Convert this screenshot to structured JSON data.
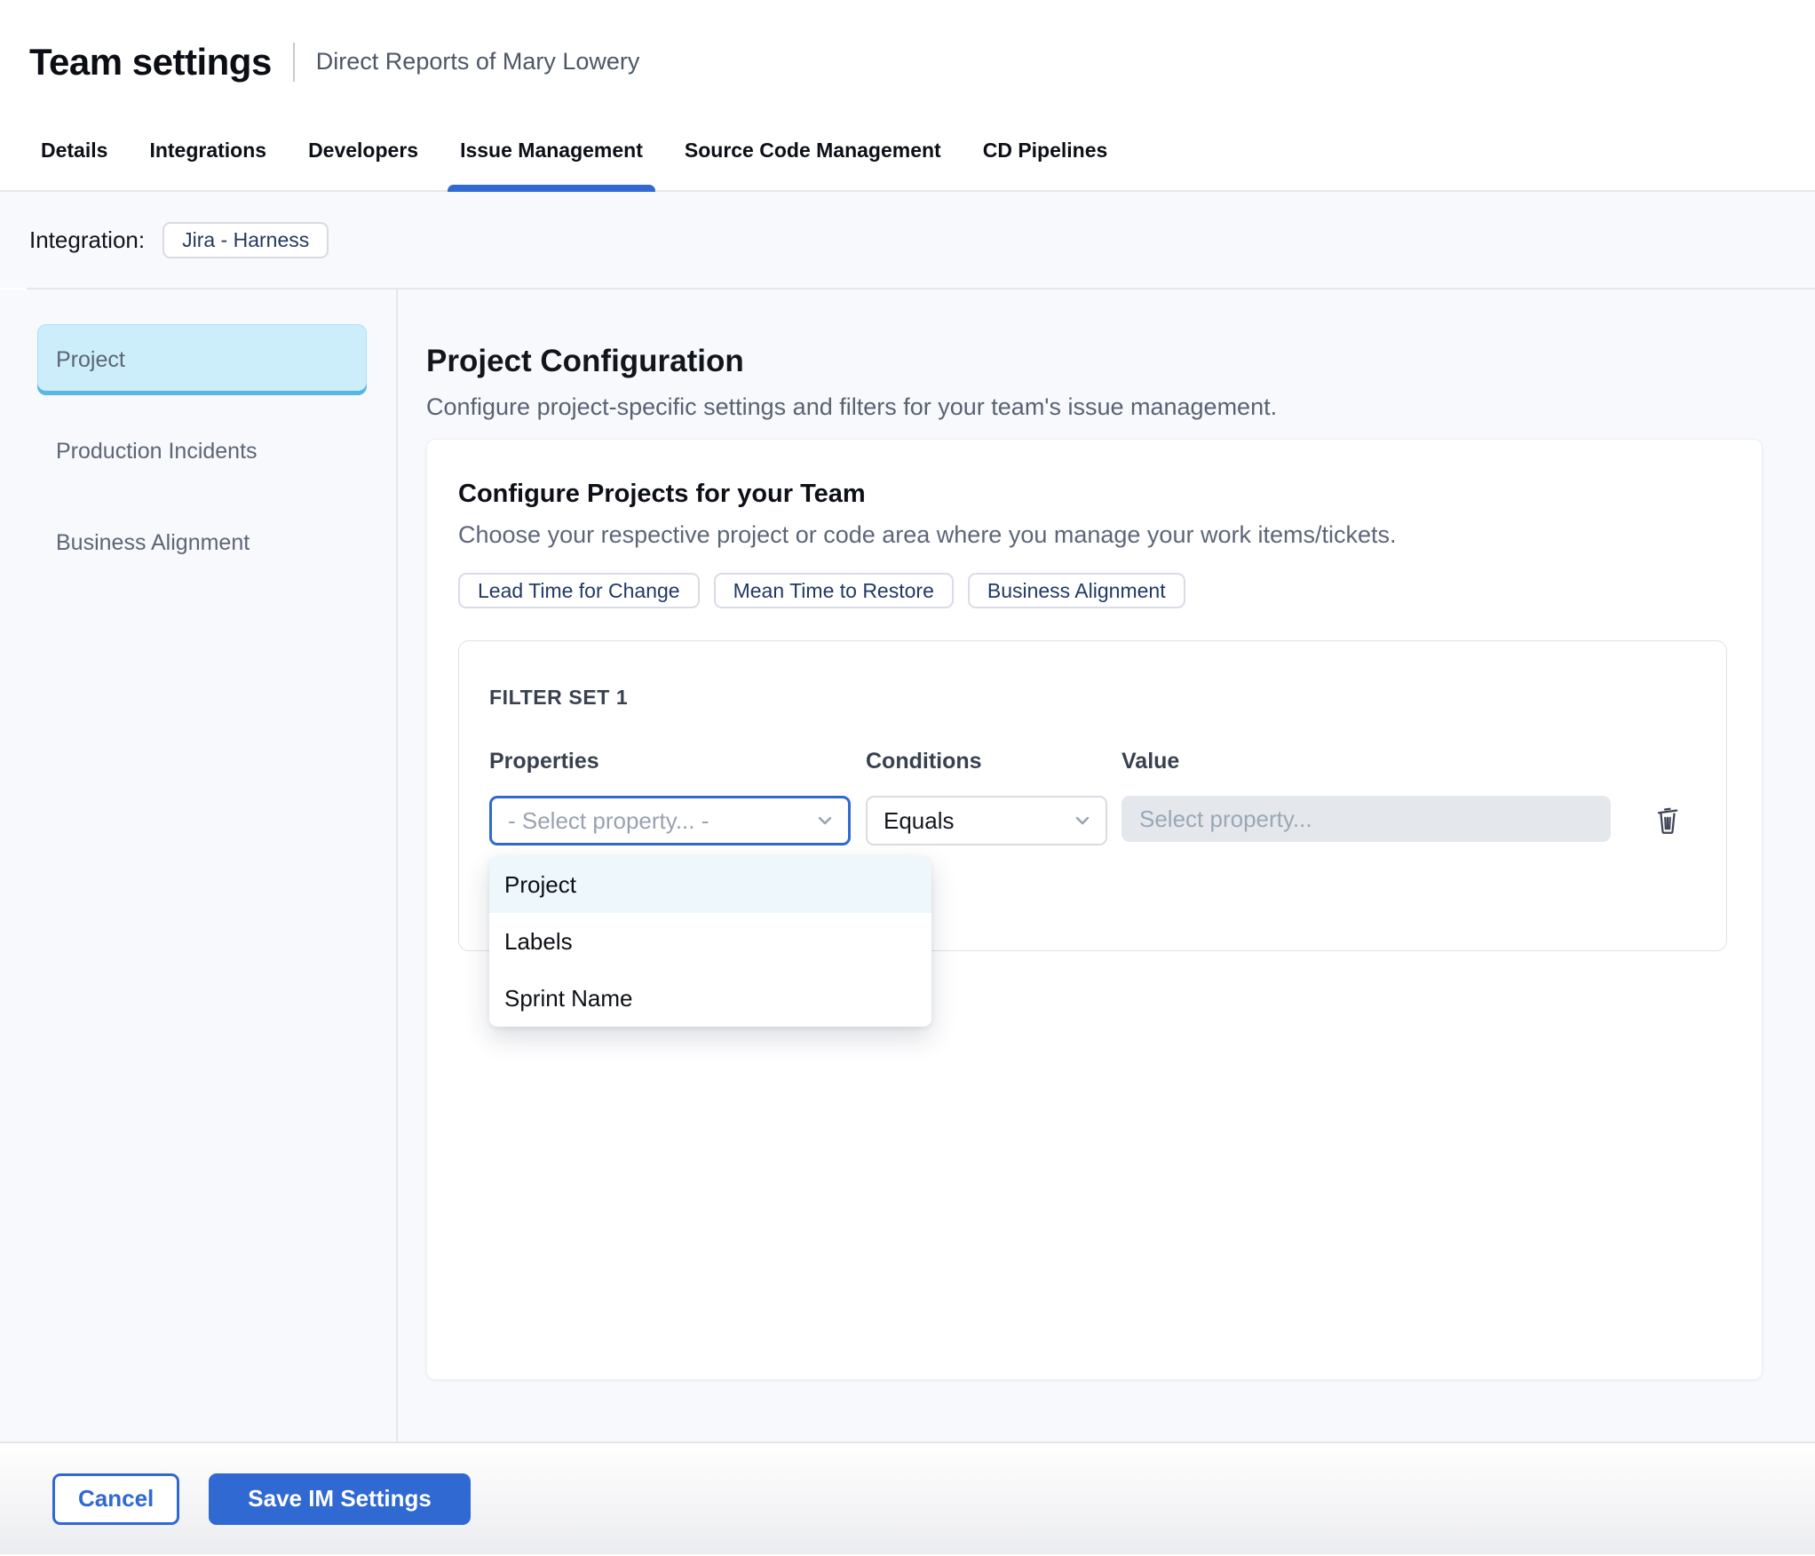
{
  "header": {
    "title": "Team settings",
    "subtitle": "Direct Reports of Mary Lowery"
  },
  "tabs": {
    "items": [
      {
        "label": "Details",
        "active": false
      },
      {
        "label": "Integrations",
        "active": false
      },
      {
        "label": "Developers",
        "active": false
      },
      {
        "label": "Issue Management",
        "active": true
      },
      {
        "label": "Source Code Management",
        "active": false
      },
      {
        "label": "CD Pipelines",
        "active": false
      }
    ]
  },
  "integration": {
    "label": "Integration:",
    "value": "Jira - Harness"
  },
  "sidebar": {
    "items": [
      "Project",
      "Production Incidents",
      "Business Alignment"
    ],
    "active_item": "Project"
  },
  "main": {
    "heading": "Project Configuration",
    "description": "Configure project-specific settings and filters for your team's issue management.",
    "card": {
      "title": "Configure Projects for your Team",
      "subtitle": "Choose your respective project or code area where you manage your work items/tickets.",
      "metric_tabs": [
        "Lead Time for Change",
        "Mean Time to Restore",
        "Business Alignment"
      ],
      "filter_set": {
        "title": "FILTER SET 1",
        "columns": [
          "Properties",
          "Conditions",
          "Value"
        ],
        "property_placeholder": "- Select property... -",
        "condition_value": "Equals",
        "value_placeholder": "Select property...",
        "dropdown_options": [
          "Project",
          "Labels",
          "Sprint Name"
        ],
        "highlighted_option": "Project"
      }
    }
  },
  "footer": {
    "cancel_label": "Cancel",
    "save_label": "Save IM Settings"
  },
  "colors": {
    "primary_blue": "#3069d1",
    "active_sidebar_bg": "#cbeefa",
    "active_sidebar_border": "#58b7e8",
    "highlighted_option_bg": "#edf7fc"
  }
}
